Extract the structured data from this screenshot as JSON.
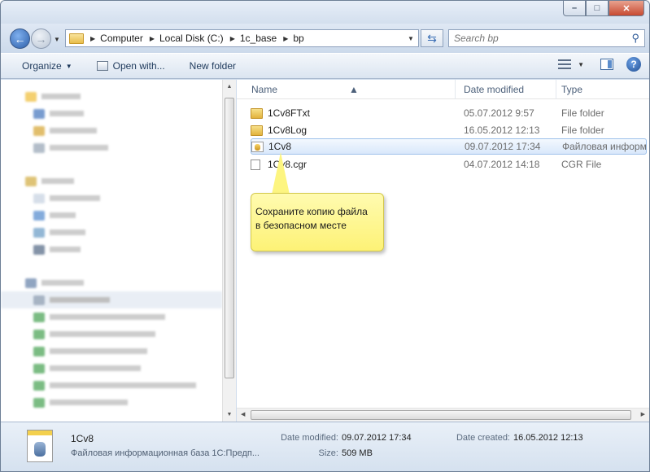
{
  "address": {
    "crumbs": [
      "Computer",
      "Local Disk (C:)",
      "1c_base",
      "bp"
    ]
  },
  "search": {
    "placeholder": "Search bp"
  },
  "toolbar": {
    "organize": "Organize",
    "open_with": "Open with...",
    "new_folder": "New folder"
  },
  "columns": {
    "name": "Name",
    "date": "Date modified",
    "type": "Type"
  },
  "files": [
    {
      "name": "1Cv8FTxt",
      "date": "05.07.2012 9:57",
      "type": "File folder",
      "icon": "folder-icon"
    },
    {
      "name": "1Cv8Log",
      "date": "16.05.2012 12:13",
      "type": "File folder",
      "icon": "folder-icon"
    },
    {
      "name": "1Cv8",
      "date": "09.07.2012 17:34",
      "type": "Файловая информ...",
      "icon": "database-file-icon",
      "selected": true
    },
    {
      "name": "1Cv8.cgr",
      "date": "04.07.2012 14:18",
      "type": "CGR File",
      "icon": "file-icon"
    }
  ],
  "tooltip": {
    "line1": "Сохраните копию файла",
    "line2": "в безопасном месте"
  },
  "details": {
    "name": "1Cv8",
    "description": "Файловая информационная база 1С:Предп...",
    "date_modified_label": "Date modified:",
    "date_modified": "09.07.2012 17:34",
    "date_created_label": "Date created:",
    "date_created": "16.05.2012 12:13",
    "size_label": "Size:",
    "size": "509 MB"
  },
  "colors": {
    "selection": "#d9e8fb",
    "tooltip": "#fdf276",
    "chrome": "#cfdcec"
  }
}
